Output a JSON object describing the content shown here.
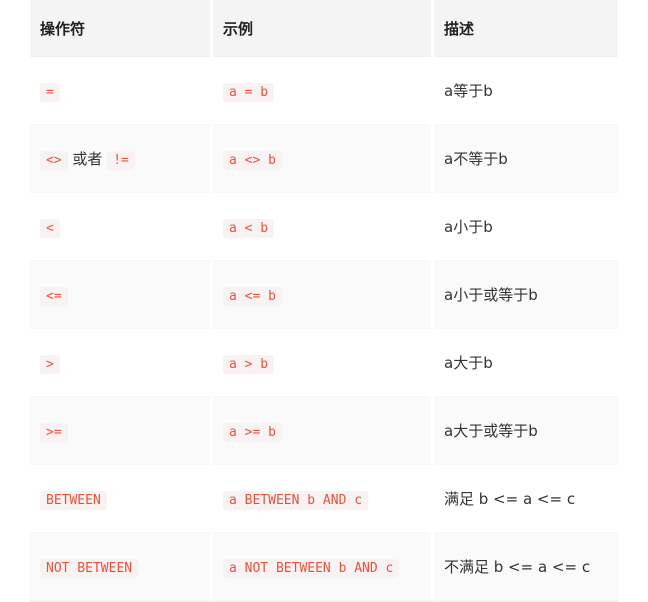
{
  "table": {
    "headers": [
      "操作符",
      "示例",
      "描述"
    ],
    "rows": [
      {
        "operator": "=",
        "example": "a = b",
        "description": "a等于b"
      },
      {
        "operator": "<>",
        "operator_joiner": " 或者 ",
        "operator_alt": "!=",
        "example": "a <> b",
        "description": "a不等于b"
      },
      {
        "operator": "<",
        "example": "a < b",
        "description": "a小于b"
      },
      {
        "operator": "<=",
        "example": "a <= b",
        "description": "a小于或等于b"
      },
      {
        "operator": ">",
        "example": "a > b",
        "description": "a大于b"
      },
      {
        "operator": ">=",
        "example": "a >= b",
        "description": "a大于或等于b"
      },
      {
        "operator": "BETWEEN",
        "example": "a BETWEEN b AND c",
        "description": "满足 b <= a <= c"
      },
      {
        "operator": "NOT BETWEEN",
        "example": "a NOT BETWEEN b AND c",
        "description": "不满足 b <= a <= c"
      }
    ]
  },
  "colors": {
    "code_text": "#e4533c",
    "code_bg": "#f9f2f2",
    "header_bg": "#f4f4f4",
    "row_alt_bg": "#fafafa"
  }
}
